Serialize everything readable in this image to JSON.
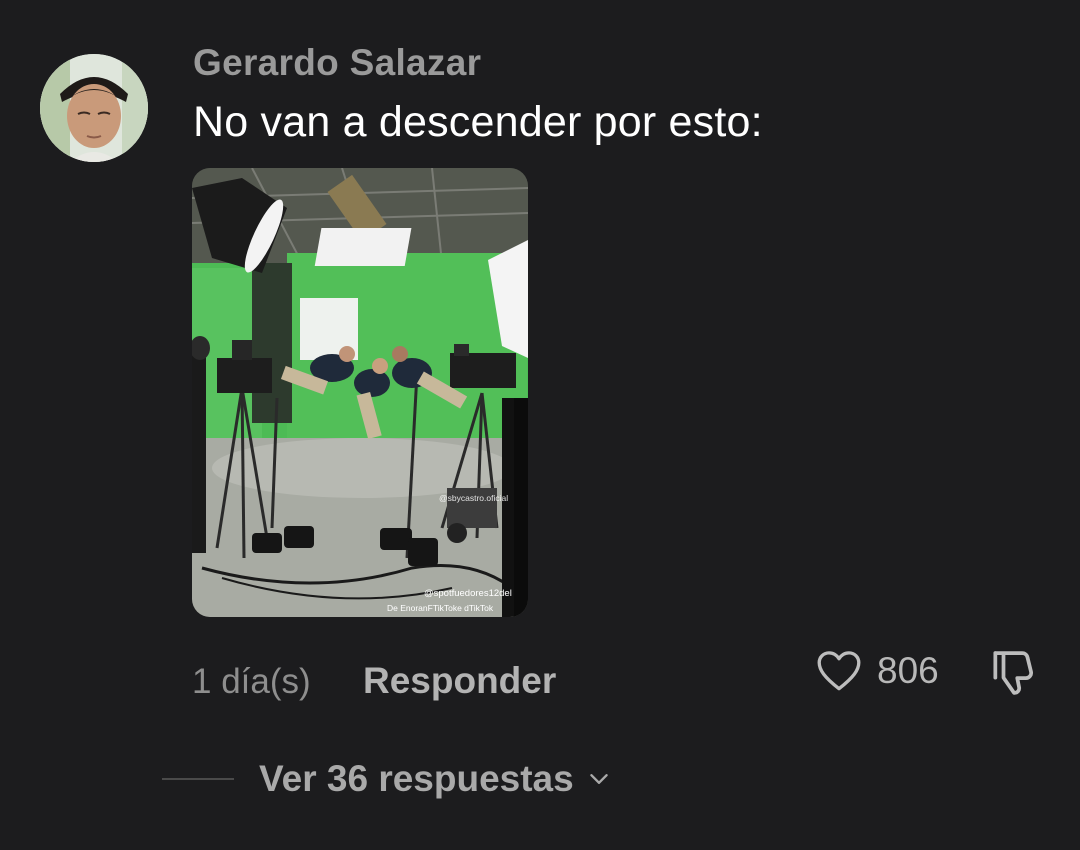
{
  "comment": {
    "username": "Gerardo Salazar",
    "text": "No van a descender por esto:",
    "timestamp": "1 día(s)",
    "reply_label": "Responder",
    "like_count": "806"
  },
  "media": {
    "watermark_handle": "@sbycastro.oficial",
    "watermark_source_handle": "@spotfuedores12del",
    "watermark_source_label": "De EnoranFTikToke dTikTok"
  },
  "replies": {
    "label": "Ver 36 respuestas"
  },
  "icons": {
    "like": "heart-icon",
    "dislike": "thumbs-down-icon",
    "expand": "chevron-down-icon"
  },
  "colors": {
    "background": "#1c1c1e",
    "username": "#9a9a9a",
    "text": "#ffffff",
    "muted": "#8e8e8e"
  }
}
